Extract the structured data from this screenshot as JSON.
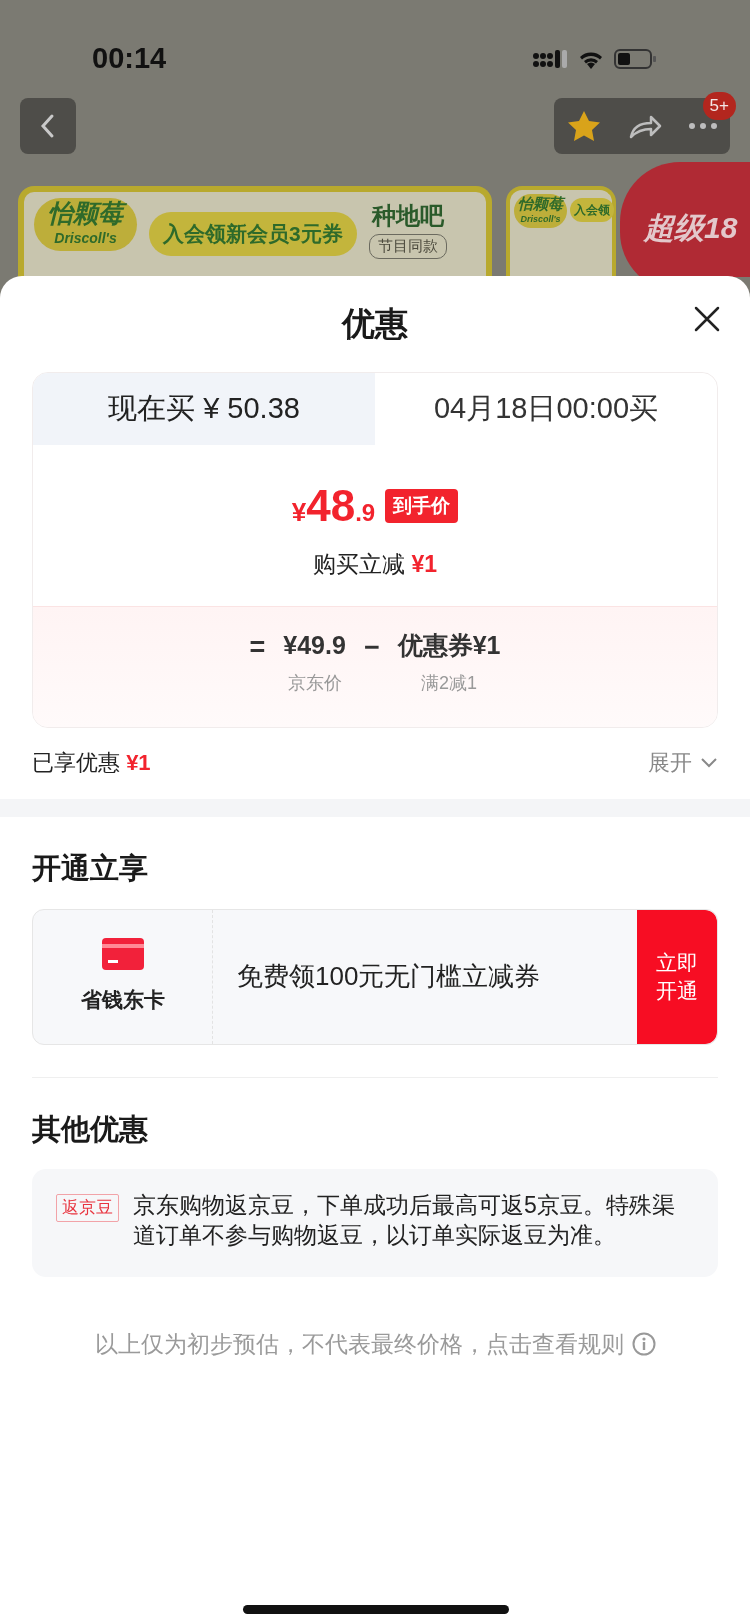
{
  "status_bar": {
    "time": "00:14"
  },
  "nav": {
    "badge": "5+"
  },
  "banners": [
    {
      "logo": "怡颗莓",
      "logo_sub": "Driscoll's",
      "slogan": "入会领新会员3元券",
      "show_logo": "种地吧",
      "show_tag": "节目同款"
    },
    {
      "logo": "怡颗莓",
      "logo_sub": "Driscoll's",
      "slogan": "入会领"
    }
  ],
  "promo_badge": "超级18",
  "sheet": {
    "title": "优惠",
    "tabs": [
      {
        "label": "现在买 ¥ 50.38",
        "selected": false
      },
      {
        "label": "04月18日00:00买",
        "selected": true
      }
    ],
    "final_price": {
      "currency": "¥",
      "integer": "48",
      "decimal": ".9",
      "tag": "到手价"
    },
    "instant_discount": {
      "label": "购买立减",
      "amount": "¥1"
    },
    "formula": [
      {
        "kind": "operator",
        "text": "="
      },
      {
        "kind": "term",
        "value": "¥49.9",
        "caption": "京东价"
      },
      {
        "kind": "operator",
        "text": "−"
      },
      {
        "kind": "term",
        "value": "优惠券¥1",
        "caption": "满2减1"
      }
    ],
    "enjoyed": {
      "label": "已享优惠",
      "amount": "¥1"
    },
    "expand": {
      "label": "展开",
      "expanded": false
    }
  },
  "membership": {
    "heading": "开通立享",
    "card_name": "省钱东卡",
    "offer": "免费领100元无门槛立减券",
    "button": "立即开通"
  },
  "other": {
    "heading": "其他优惠",
    "items": [
      {
        "tag": "返京豆",
        "text": "京东购物返京豆，下单成功后最高可返5京豆。特殊渠道订单不参与购物返豆，以订单实际返豆为准。"
      }
    ]
  },
  "footnote": "以上仅为初步预估，不代表最终价格，点击查看规则"
}
